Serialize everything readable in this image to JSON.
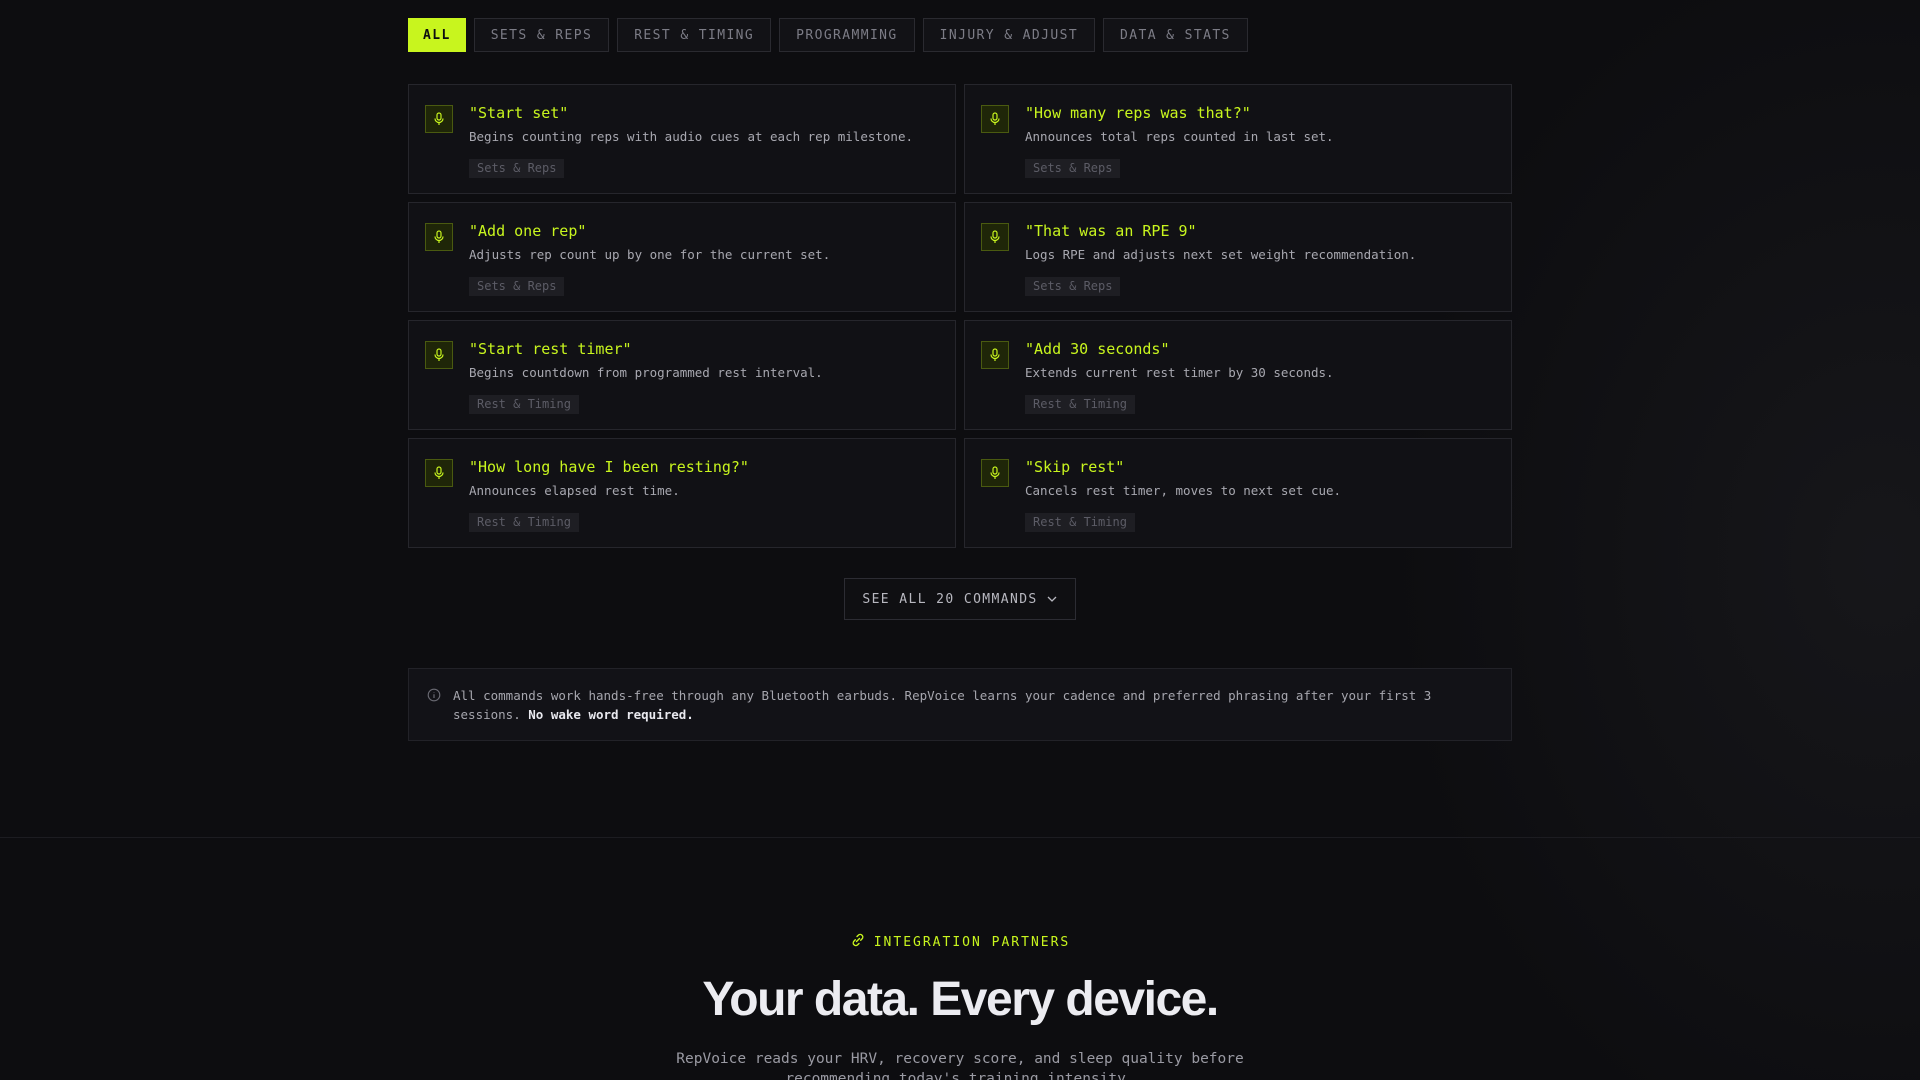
{
  "tabs": [
    {
      "label": "ALL",
      "active": true
    },
    {
      "label": "SETS & REPS",
      "active": false
    },
    {
      "label": "REST & TIMING",
      "active": false
    },
    {
      "label": "PROGRAMMING",
      "active": false
    },
    {
      "label": "INJURY & ADJUST",
      "active": false
    },
    {
      "label": "DATA & STATS",
      "active": false
    }
  ],
  "commands": [
    {
      "title": "\"Start set\"",
      "desc": "Begins counting reps with audio cues at each rep milestone.",
      "tag": "Sets & Reps"
    },
    {
      "title": "\"How many reps was that?\"",
      "desc": "Announces total reps counted in last set.",
      "tag": "Sets & Reps"
    },
    {
      "title": "\"Add one rep\"",
      "desc": "Adjusts rep count up by one for the current set.",
      "tag": "Sets & Reps"
    },
    {
      "title": "\"That was an RPE 9\"",
      "desc": "Logs RPE and adjusts next set weight recommendation.",
      "tag": "Sets & Reps"
    },
    {
      "title": "\"Start rest timer\"",
      "desc": "Begins countdown from programmed rest interval.",
      "tag": "Rest & Timing"
    },
    {
      "title": "\"Add 30 seconds\"",
      "desc": "Extends current rest timer by 30 seconds.",
      "tag": "Rest & Timing"
    },
    {
      "title": "\"How long have I been resting?\"",
      "desc": "Announces elapsed rest time.",
      "tag": "Rest & Timing"
    },
    {
      "title": "\"Skip rest\"",
      "desc": "Cancels rest timer, moves to next set cue.",
      "tag": "Rest & Timing"
    }
  ],
  "see_all": {
    "label": "SEE ALL 20 COMMANDS"
  },
  "note": {
    "text": "All commands work hands-free through any Bluetooth earbuds. RepVoice learns your cadence and preferred phrasing after your first 3 sessions.",
    "bold": "No wake word required."
  },
  "partners": {
    "label": "INTEGRATION PARTNERS",
    "headline": "Your data. Every device.",
    "subtext": "RepVoice reads your HRV, recovery score, and sleep quality before recommending today's training intensity."
  },
  "colors": {
    "accent": "#c8f51e",
    "background": "#0d0d10"
  }
}
